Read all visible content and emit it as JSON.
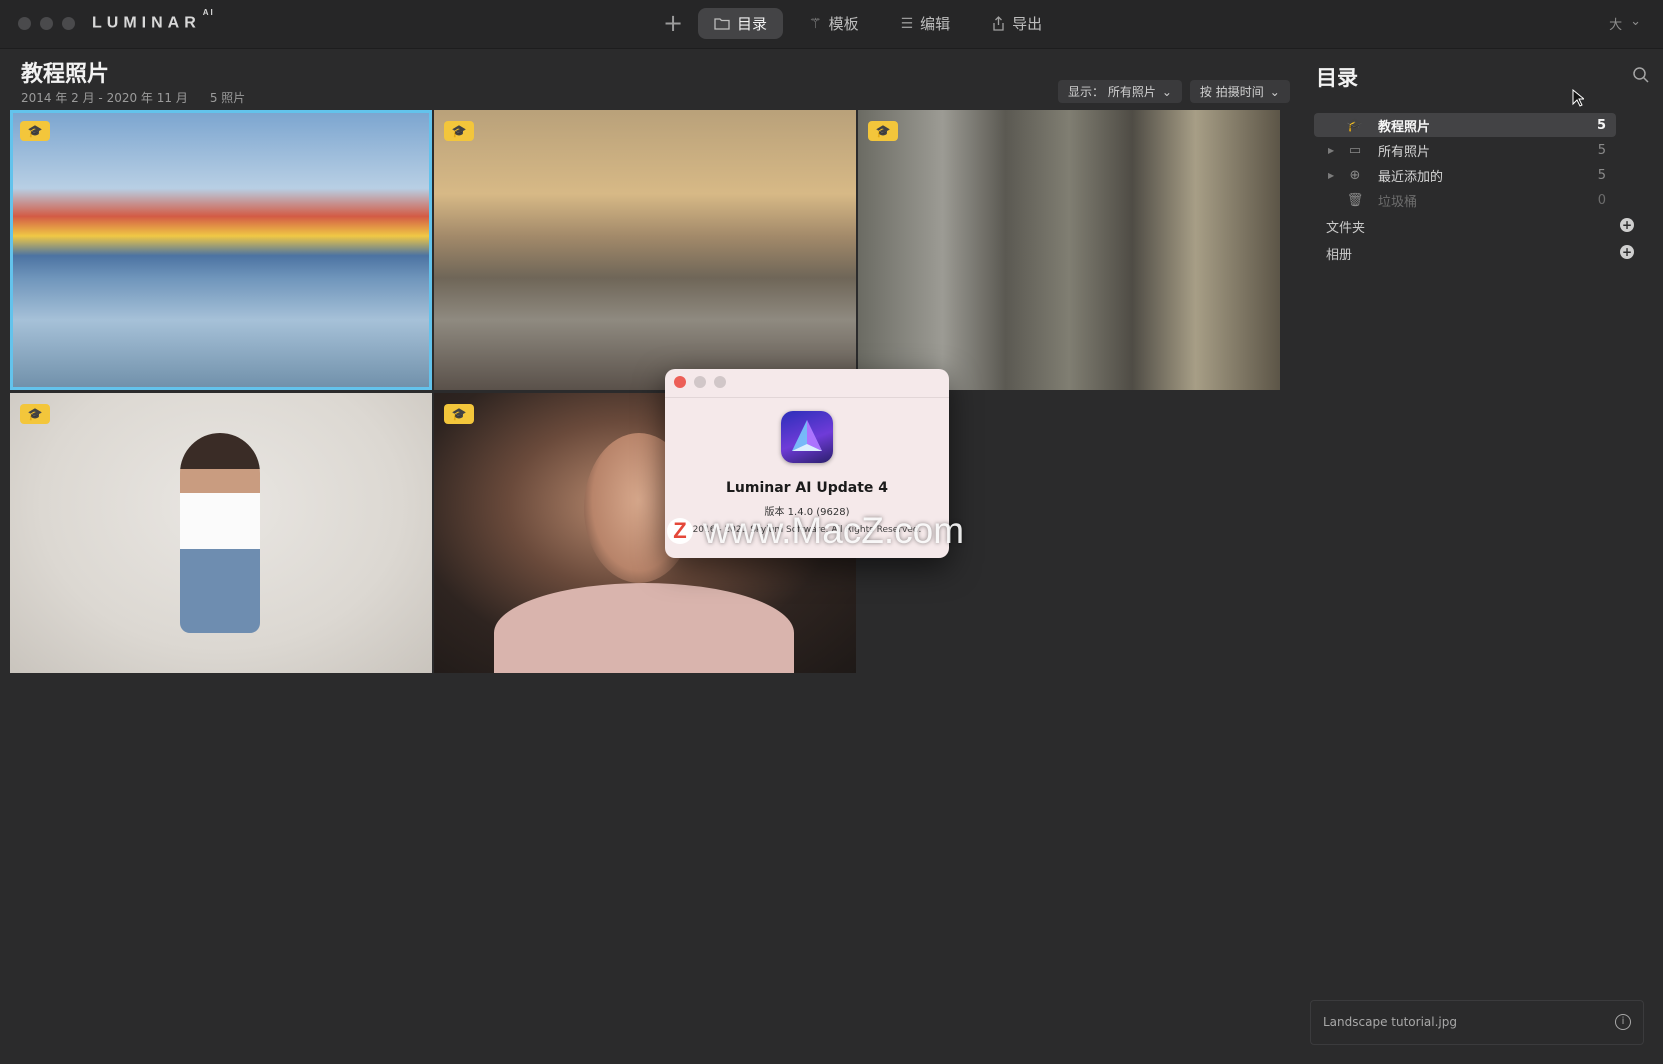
{
  "titlebar": {
    "brand": "LUMINAR",
    "brand_sup": "AI",
    "add_icon": "plus-icon",
    "tabs": [
      {
        "label": "目录",
        "icon": "folder-icon",
        "active": true
      },
      {
        "label": "模板",
        "icon": "magic-wand-icon",
        "active": false
      },
      {
        "label": "编辑",
        "icon": "sliders-icon",
        "active": false
      },
      {
        "label": "导出",
        "icon": "share-icon",
        "active": false
      }
    ],
    "size_label": "大"
  },
  "header": {
    "title": "教程照片",
    "date_range": "2014 年 2 月 - 2020 年 11 月",
    "count": "5 照片",
    "filter_show": "显示： 所有照片",
    "filter_sort": "按 拍摄时间"
  },
  "photos": [
    {
      "name": "Landscape tutorial.jpg",
      "badge_icon": "graduation-cap-icon",
      "selected": true
    },
    {
      "badge_icon": "graduation-cap-icon",
      "selected": false
    },
    {
      "badge_icon": "graduation-cap-icon",
      "selected": false
    },
    {
      "badge_icon": "graduation-cap-icon",
      "selected": false
    },
    {
      "badge_icon": "graduation-cap-icon",
      "selected": false
    }
  ],
  "dialog": {
    "title": "Luminar AI Update 4",
    "version": "版本 1.4.0 (9628)",
    "copyright": "2016 - 2021 Skylum Software. All Rights Reserved."
  },
  "watermark": {
    "logo": "Z",
    "text": "www.MacZ.com"
  },
  "sidebar": {
    "title": "目录",
    "items": [
      {
        "label": "教程照片",
        "count": "5",
        "icon": "graduation-cap-icon",
        "active": true
      },
      {
        "label": "所有照片",
        "count": "5",
        "icon": "photos-icon",
        "active": false
      },
      {
        "label": "最近添加的",
        "count": "5",
        "icon": "plus-circle-icon",
        "active": false
      },
      {
        "label": "垃圾桶",
        "count": "0",
        "icon": "trash-icon",
        "active": false
      }
    ],
    "folders_label": "文件夹",
    "albums_label": "相册"
  },
  "info_bar": {
    "filename": "Landscape tutorial.jpg"
  }
}
